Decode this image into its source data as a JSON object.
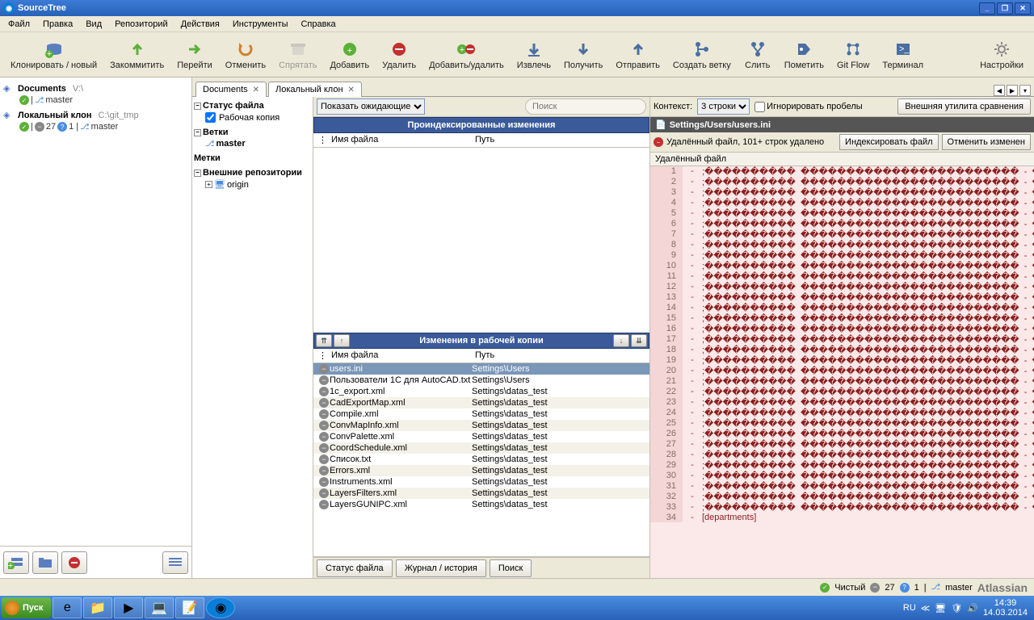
{
  "title": "SourceTree",
  "menubar": [
    "Файл",
    "Правка",
    "Вид",
    "Репозиторий",
    "Действия",
    "Инструменты",
    "Справка"
  ],
  "toolbar": [
    {
      "label": "Клонировать / новый",
      "color": "#5cb038"
    },
    {
      "label": "Закоммитить",
      "color": "#5cb038"
    },
    {
      "label": "Перейти",
      "color": "#5cb038"
    },
    {
      "label": "Отменить",
      "color": "#d08030"
    },
    {
      "label": "Спрятать",
      "color": "#888",
      "disabled": true
    },
    {
      "label": "Добавить",
      "color": "#5cb038"
    },
    {
      "label": "Удалить",
      "color": "#c23030"
    },
    {
      "label": "Добавить/удалить",
      "color": "#5cb038"
    },
    {
      "label": "Извлечь",
      "color": "#4a6fa0"
    },
    {
      "label": "Получить",
      "color": "#4a6fa0"
    },
    {
      "label": "Отправить",
      "color": "#4a6fa0"
    },
    {
      "label": "Создать ветку",
      "color": "#4a6fa0"
    },
    {
      "label": "Слить",
      "color": "#4a6fa0"
    },
    {
      "label": "Пометить",
      "color": "#4a6fa0"
    },
    {
      "label": "Git Flow",
      "color": "#4a6fa0"
    },
    {
      "label": "Терминал",
      "color": "#4a6fa0"
    }
  ],
  "toolbar_right": {
    "label": "Настройки",
    "color": "#888"
  },
  "sidebar": {
    "repos": [
      {
        "name": "Documents",
        "path": "V:\\",
        "branch": "master"
      },
      {
        "name": "Локальный клон",
        "path": "C:\\git_tmp",
        "badges": {
          "minus": "27",
          "q": "1"
        },
        "branch": "master"
      }
    ]
  },
  "tabs": [
    {
      "label": "Documents"
    },
    {
      "label": "Локальный клон",
      "active": true
    }
  ],
  "leftpanel": {
    "file_status": "Статус файла",
    "working_copy": "Рабочая копия",
    "branches": "Ветки",
    "master": "master",
    "tags": "Метки",
    "remotes": "Внешние репозитории",
    "origin": "origin"
  },
  "center": {
    "filter": "Показать ожидающие",
    "search_placeholder": "Поиск",
    "banner1": "Проиндексированные изменения",
    "col_file": "Имя файла",
    "col_path": "Путь",
    "banner2": "Изменения в рабочей копии",
    "files": [
      {
        "name": "users.ini",
        "path": "Settings\\Users",
        "sel": true,
        "icon": "minus"
      },
      {
        "name": "Пользователи 1С для AutoCAD.txt",
        "path": "Settings\\Users",
        "icon": "minus"
      },
      {
        "name": "1c_export.xml",
        "path": "Settings\\datas_test",
        "icon": "minus"
      },
      {
        "name": "CadExportMap.xml",
        "path": "Settings\\datas_test",
        "icon": "minus",
        "alt": true
      },
      {
        "name": "Compile.xml",
        "path": "Settings\\datas_test",
        "icon": "minus"
      },
      {
        "name": "ConvMapInfo.xml",
        "path": "Settings\\datas_test",
        "icon": "minus",
        "alt": true
      },
      {
        "name": "ConvPalette.xml",
        "path": "Settings\\datas_test",
        "icon": "minus"
      },
      {
        "name": "CoordSchedule.xml",
        "path": "Settings\\datas_test",
        "icon": "minus",
        "alt": true
      },
      {
        "name": "Список.txt",
        "path": "Settings\\datas_test",
        "icon": "minus"
      },
      {
        "name": "Errors.xml",
        "path": "Settings\\datas_test",
        "icon": "minus",
        "alt": true
      },
      {
        "name": "Instruments.xml",
        "path": "Settings\\datas_test",
        "icon": "minus"
      },
      {
        "name": "LayersFilters.xml",
        "path": "Settings\\datas_test",
        "icon": "minus",
        "alt": true
      },
      {
        "name": "LayersGUNIPC.xml",
        "path": "Settings\\datas_test",
        "icon": "minus"
      }
    ],
    "bottom_tabs": [
      "Статус файла",
      "Журнал / история",
      "Поиск"
    ]
  },
  "right": {
    "context_label": "Контекст:",
    "context_value": "3 строки",
    "ignore_ws": "Игнорировать пробелы",
    "ext_diff": "Внешняя утилита сравнения",
    "file": "Settings/Users/users.ini",
    "status": "Удалённый файл, 101+ строк удалено",
    "btn_index": "Индексировать файл",
    "btn_discard": "Отменить изменен",
    "deleted_head": "Удалённый файл",
    "diff_special": {
      "line": 34,
      "text": "[departments]"
    }
  },
  "statusbar": {
    "clean": "Чистый",
    "minus": "27",
    "q": "1",
    "branch": "master"
  },
  "taskbar": {
    "start": "Пуск",
    "lang": "RU",
    "time": "14:39",
    "date": "14.03.2014"
  }
}
